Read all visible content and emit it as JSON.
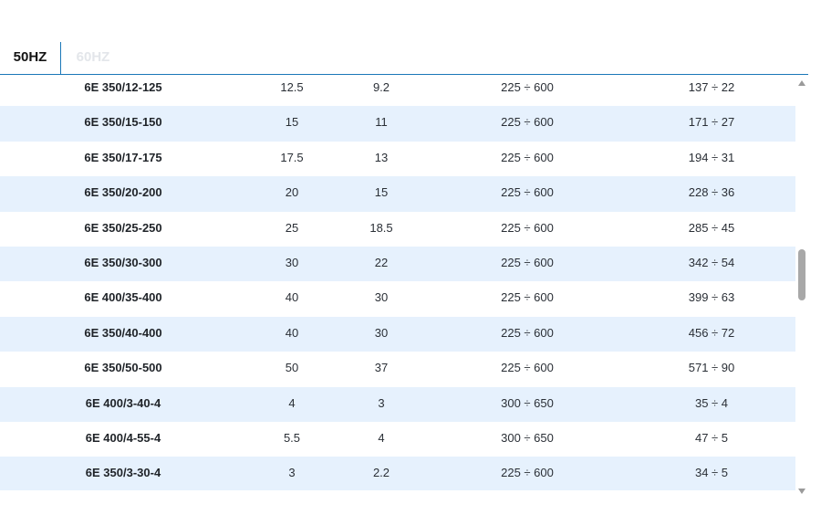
{
  "tabs": [
    {
      "label": "50HZ",
      "active": true
    },
    {
      "label": "60HZ",
      "active": false
    }
  ],
  "table": {
    "rows": [
      [
        "6E 350/12-125",
        "12.5",
        "9.2",
        "225 ÷ 600",
        "137 ÷ 22"
      ],
      [
        "6E 350/15-150",
        "15",
        "11",
        "225 ÷ 600",
        "171 ÷ 27"
      ],
      [
        "6E 350/17-175",
        "17.5",
        "13",
        "225 ÷ 600",
        "194 ÷ 31"
      ],
      [
        "6E 350/20-200",
        "20",
        "15",
        "225 ÷ 600",
        "228 ÷ 36"
      ],
      [
        "6E 350/25-250",
        "25",
        "18.5",
        "225 ÷ 600",
        "285 ÷ 45"
      ],
      [
        "6E 350/30-300",
        "30",
        "22",
        "225 ÷ 600",
        "342 ÷ 54"
      ],
      [
        "6E 400/35-400",
        "40",
        "30",
        "225 ÷ 600",
        "399 ÷ 63"
      ],
      [
        "6E 350/40-400",
        "40",
        "30",
        "225 ÷ 600",
        "456 ÷ 72"
      ],
      [
        "6E 350/50-500",
        "50",
        "37",
        "225 ÷ 600",
        "571 ÷ 90"
      ],
      [
        "6E 400/3-40-4",
        "4",
        "3",
        "300 ÷ 650",
        "35 ÷ 4"
      ],
      [
        "6E 400/4-55-4",
        "5.5",
        "4",
        "300 ÷ 650",
        "47 ÷ 5"
      ],
      [
        "6E 350/3-30-4",
        "3",
        "2.2",
        "225 ÷ 600",
        "34 ÷ 5"
      ]
    ]
  },
  "scrollbar": {
    "icons": [
      "scroll-up-arrow-icon",
      "scroll-down-arrow-icon"
    ],
    "position_fraction": 0.5
  },
  "colors": {
    "accent": "#1a78b8",
    "row_alt": "#e6f1fd",
    "inactive_tab": "#e3e6ea"
  }
}
